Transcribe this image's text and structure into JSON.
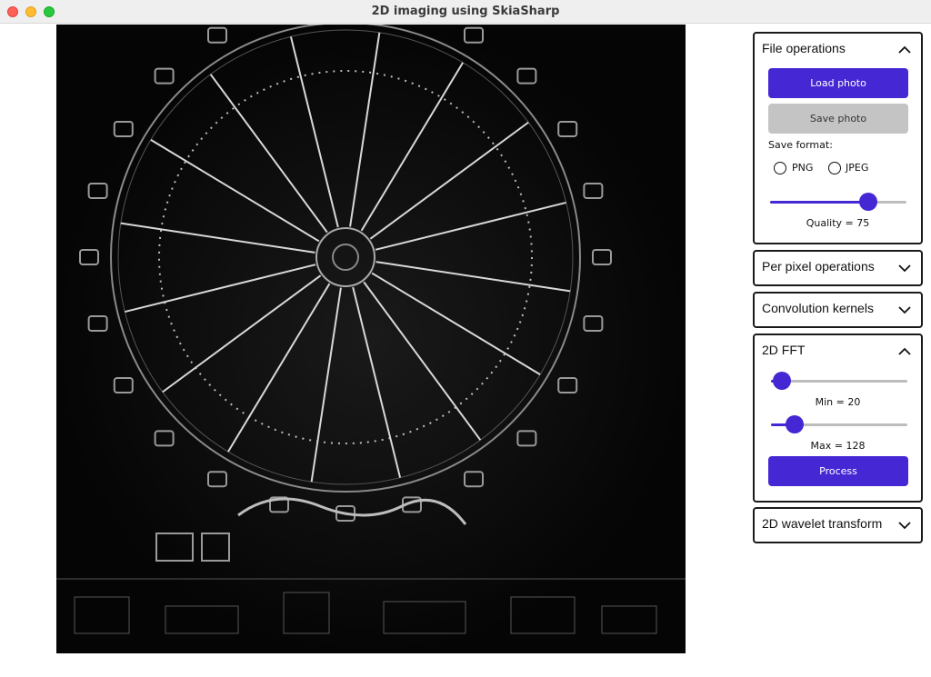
{
  "window": {
    "title": "2D imaging using SkiaSharp"
  },
  "canvas": {
    "description_icon": "image-canvas"
  },
  "panels": {
    "file_operations": {
      "title": "File operations",
      "expanded": true,
      "load_label": "Load photo",
      "save_label": "Save photo",
      "save_format_label": "Save format:",
      "formats": [
        "PNG",
        "JPEG"
      ],
      "quality_value": 75,
      "quality_max": 100,
      "quality_label": "Quality = 75"
    },
    "per_pixel": {
      "title": "Per pixel operations",
      "expanded": false
    },
    "convolution": {
      "title": "Convolution kernels",
      "expanded": false
    },
    "fft": {
      "title": "2D FFT",
      "expanded": true,
      "min_label": "Min = 20",
      "max_label": "Max = 128",
      "process_label": "Process"
    },
    "wavelet": {
      "title": "2D wavelet transform",
      "expanded": false
    }
  },
  "colors": {
    "accent": "#4527d4",
    "disabled": "#c4c4c4",
    "canvas_bg": "#050505"
  }
}
